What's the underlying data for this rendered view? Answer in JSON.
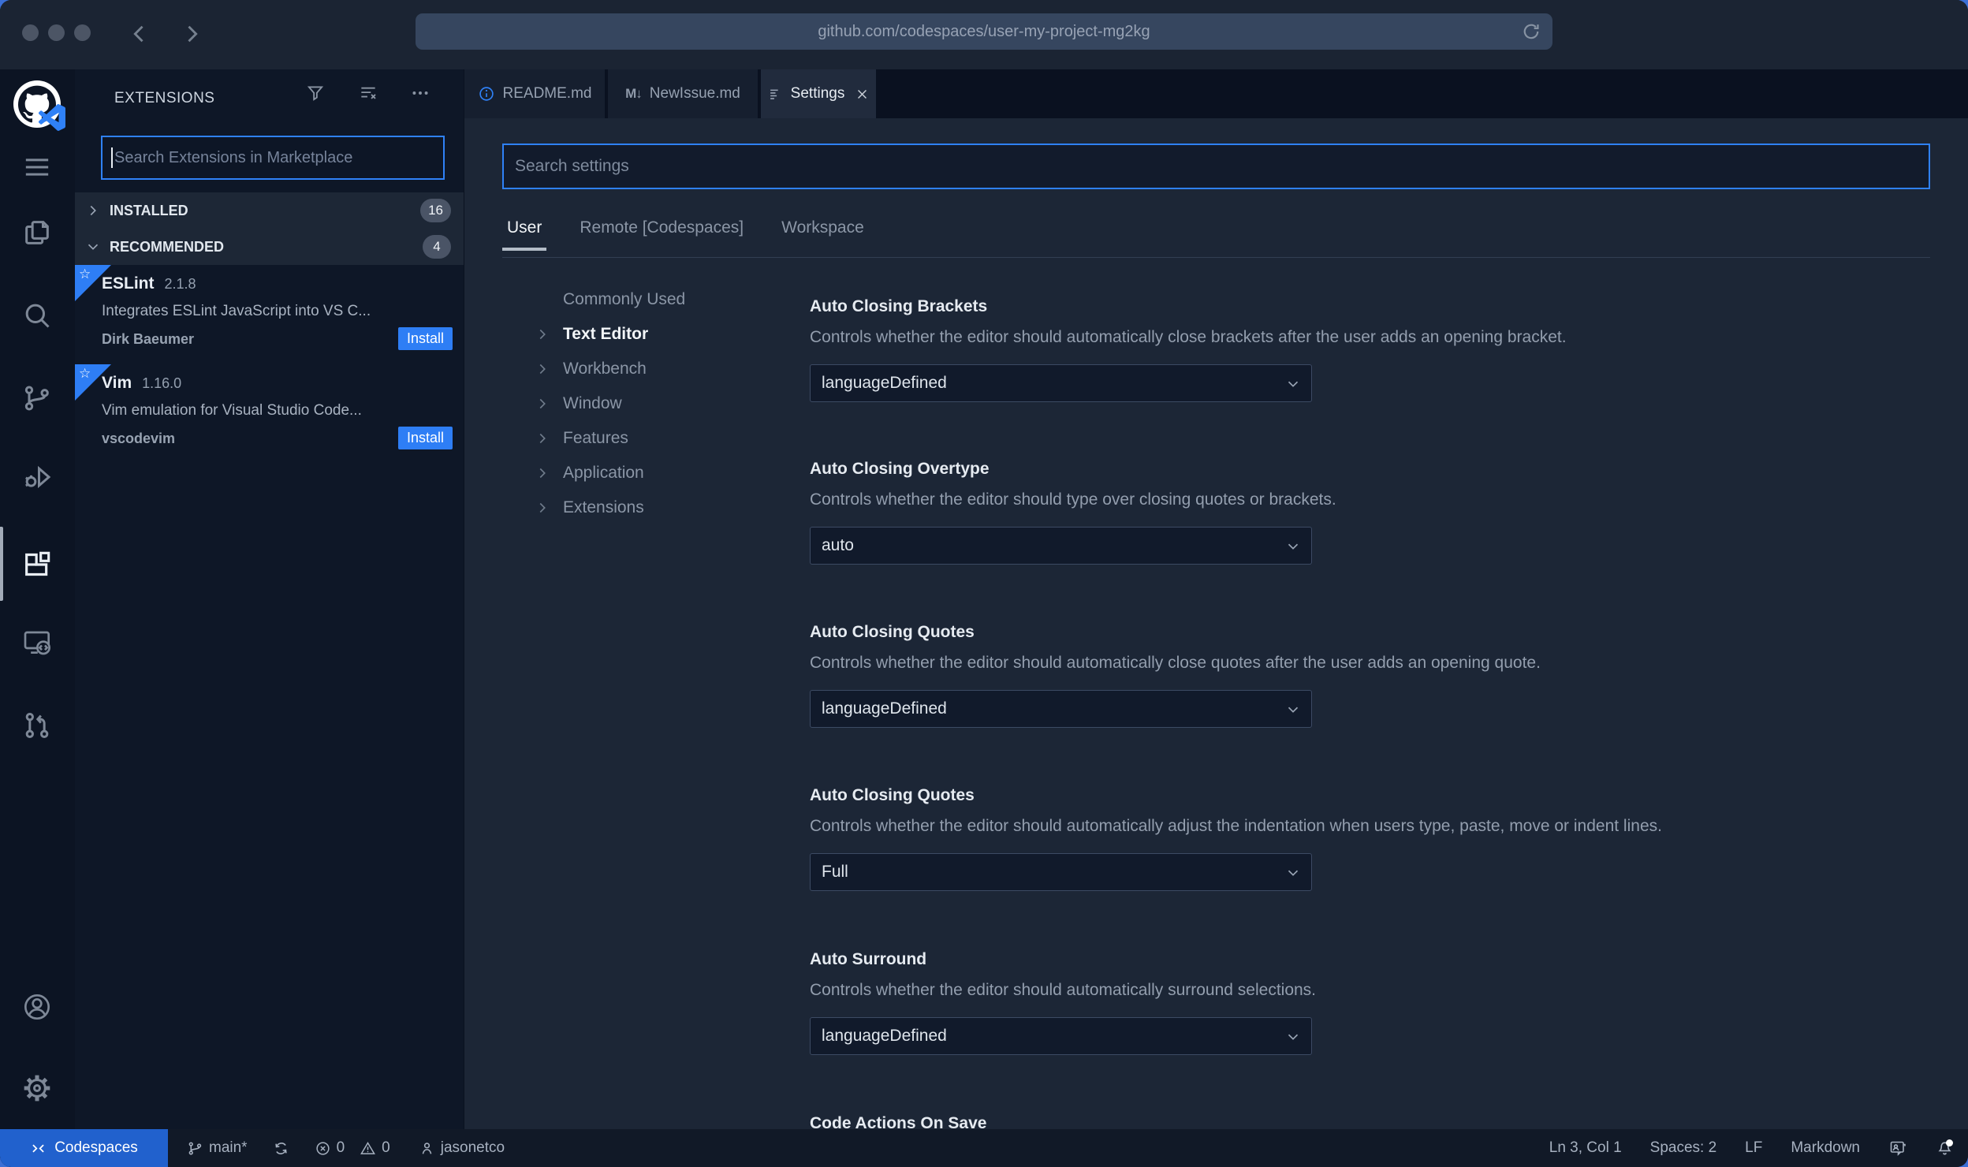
{
  "browser": {
    "url": "github.com/codespaces/user-my-project-mg2kg",
    "icons": [
      "back-chevron",
      "forward-chevron",
      "reload-icon"
    ]
  },
  "activity_bar": {
    "icons": [
      "github-codespaces-logo",
      "menu-icon",
      "explorer-icon",
      "search-icon",
      "source-control-icon",
      "run-debug-icon",
      "extensions-icon",
      "remote-explorer-icon",
      "pull-request-icon",
      "account-icon",
      "settings-gear-icon"
    ],
    "active_item": "extensions"
  },
  "extensions_panel": {
    "title": "EXTENSIONS",
    "header_icons": [
      "filter-icon",
      "clear-filter-icon",
      "more-actions-icon"
    ],
    "search_placeholder": "Search Extensions in Marketplace",
    "sections": [
      {
        "label": "INSTALLED",
        "count": "16",
        "state": "collapsed"
      },
      {
        "label": "RECOMMENDED",
        "count": "4",
        "state": "expanded"
      }
    ],
    "ribbon_glyph": "☆",
    "items": [
      {
        "name": "ESLint",
        "version": "2.1.8",
        "description": "Integrates ESLint JavaScript into VS C...",
        "author": "Dirk Baeumer",
        "action": "Install"
      },
      {
        "name": "Vim",
        "version": "1.16.0",
        "description": "Vim emulation for Visual Studio Code...",
        "author": "vscodevim",
        "action": "Install"
      }
    ]
  },
  "tabs": {
    "markdown_glyph": "M↓",
    "items": [
      {
        "label": "README.md",
        "icon": "info-icon",
        "active": false
      },
      {
        "label": "NewIssue.md",
        "icon": "markdown-icon",
        "active": false
      },
      {
        "label": "Settings",
        "icon": "tune-icon",
        "active": true,
        "closable": true
      }
    ]
  },
  "settings": {
    "search_placeholder": "Search settings",
    "scopes": [
      "User",
      "Remote [Codespaces]",
      "Workspace"
    ],
    "active_scope": "User",
    "toc": [
      "Commonly Used",
      "Text Editor",
      "Workbench",
      "Window",
      "Features",
      "Application",
      "Extensions"
    ],
    "selected_toc": "Text Editor",
    "blocks": [
      {
        "title": "Auto Closing Brackets",
        "description": "Controls whether the editor should automatically close brackets after the user adds an opening bracket.",
        "value": "languageDefined"
      },
      {
        "title": "Auto Closing Overtype",
        "description": "Controls whether the editor should type over closing quotes or brackets.",
        "value": "auto"
      },
      {
        "title": "Auto Closing Quotes",
        "description": "Controls whether the editor should automatically close quotes after the user adds an opening quote.",
        "value": "languageDefined"
      },
      {
        "title": "Auto Closing Quotes",
        "description": "Controls whether the editor should automatically adjust the indentation when users type, paste, move or indent lines.",
        "value": "Full"
      },
      {
        "title": "Auto Surround",
        "description": "Controls whether the editor should automatically surround selections.",
        "value": "languageDefined"
      },
      {
        "title": "Code Actions On Save"
      }
    ]
  },
  "status_bar": {
    "codespaces_label": "Codespaces",
    "branch": "main*",
    "errors": "0",
    "warnings": "0",
    "user": "jasonetco",
    "cursor": "Ln 3, Col 1",
    "indent": "Spaces: 2",
    "eol": "LF",
    "language": "Markdown"
  },
  "colors": {
    "accent_blue": "#2f81f7",
    "install_blue": "#2e7ef5",
    "codespaces_blue": "#2161cd",
    "desktop_blue": "#3b6fd6",
    "editor_bg": "#1c2636",
    "sidebar_bg": "#0e1727",
    "activity_bar_bg": "#0c1423",
    "status_bar_bg": "#111927"
  }
}
